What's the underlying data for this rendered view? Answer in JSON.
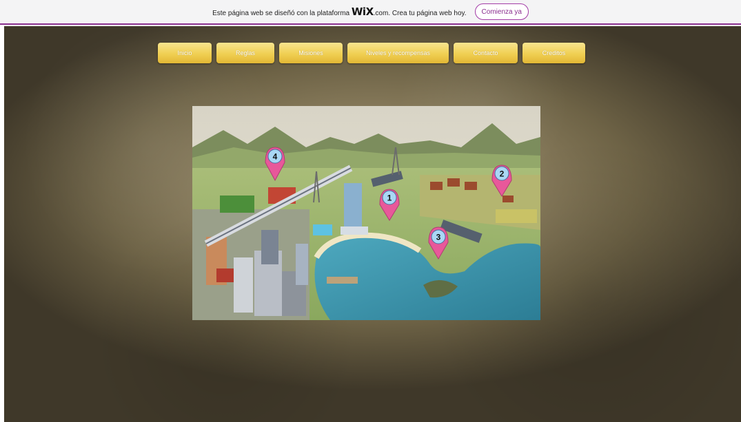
{
  "banner": {
    "text_before": "Este página web se diseñó con la plataforma",
    "logo": "WiX",
    "text_after": ".com. Crea tu página web hoy.",
    "cta_label": "Comienza ya",
    "accent_color": "#8a2f8f"
  },
  "nav": {
    "items": [
      {
        "label": "Inicio"
      },
      {
        "label": "Reglas"
      },
      {
        "label": "Misiones"
      },
      {
        "label": "Niveles y recompensas"
      },
      {
        "label": "Contacto"
      },
      {
        "label": "Creditos"
      }
    ]
  },
  "map": {
    "pins": [
      {
        "label": "1"
      },
      {
        "label": "2"
      },
      {
        "label": "3"
      },
      {
        "label": "4"
      }
    ],
    "pin_color": "#e8589a"
  }
}
